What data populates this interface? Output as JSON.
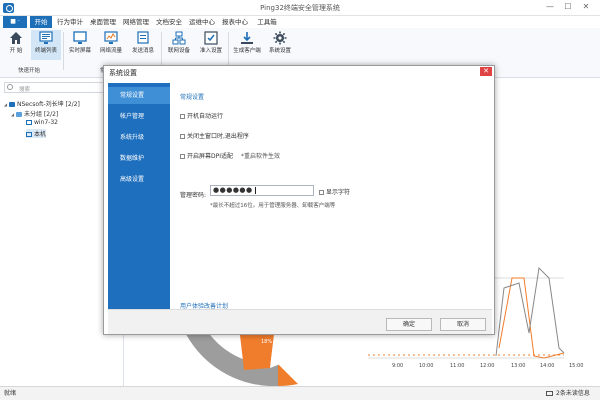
{
  "app": {
    "title": "Ping32终端安全管理系统",
    "menu_button": "■ ·"
  },
  "window": {
    "minimize": "—",
    "maximize": "☐",
    "close": "✕"
  },
  "menu": {
    "tabs": [
      "开始",
      "行为审计",
      "桌面管理",
      "网络管理",
      "文档安全",
      "运维中心",
      "报表中心",
      "工具箱"
    ],
    "active": 0
  },
  "ribbon": {
    "buttons": [
      {
        "label": "开 始",
        "icon": "home-icon"
      },
      {
        "label": "终端列表",
        "icon": "terminal-list-icon"
      },
      {
        "label": "实时屏幕",
        "icon": "monitor-icon"
      },
      {
        "label": "网络流量",
        "icon": "network-traffic-icon"
      },
      {
        "label": "发送消息",
        "icon": "message-icon"
      },
      {
        "label": "联网设备",
        "icon": "network-device-icon"
      },
      {
        "label": "准入设置",
        "icon": "access-settings-icon"
      },
      {
        "label": "生成客户端",
        "icon": "download-client-icon"
      },
      {
        "label": "系统设置",
        "icon": "gear-icon"
      }
    ],
    "groups": [
      "快速开始",
      "常"
    ]
  },
  "sidebar": {
    "search_placeholder": "搜索",
    "tree": [
      {
        "label": "NSecsoft-刘长坤 [2/2]",
        "icon": "organization-icon"
      },
      {
        "label": "未分组 [2/2]",
        "icon": "group-icon"
      },
      {
        "label": "win7-32",
        "icon": "computer-icon"
      },
      {
        "label": "本机",
        "icon": "computer-icon"
      }
    ],
    "tree_toggles": [
      "◢",
      "◢"
    ]
  },
  "background_chart": {
    "time_labels": [
      "9:00",
      "10:00",
      "11:00",
      "12:00",
      "13:00",
      "14:00",
      "15:00"
    ],
    "pie_label": "18%"
  },
  "statusbar": {
    "left": "就绪",
    "right": "2条未读信息",
    "mail_icon": "mail-icon"
  },
  "modal": {
    "title": "系统设置",
    "close": "✕",
    "nav": [
      "常规设置",
      "帐户管理",
      "系统升级",
      "数据维护",
      "高级设置"
    ],
    "active_nav": 0,
    "section_title": "常规设置",
    "options": [
      {
        "label": "开机自动运行",
        "checked": false
      },
      {
        "label": "关闭主窗口时,退出程序",
        "checked": false
      },
      {
        "label": "开启屏幕DPI适配",
        "hint": "*重启软件生效",
        "checked": false
      }
    ],
    "password_label": "管理密码:",
    "password_value": "●●●●●●",
    "show_chars_label": "显示字符",
    "password_note": "*最长不超过16位。用于管理服务器、卸载客户端等",
    "improvement_link": "用户体验改善计划",
    "ok_button": "确定",
    "cancel_button": "取消"
  }
}
